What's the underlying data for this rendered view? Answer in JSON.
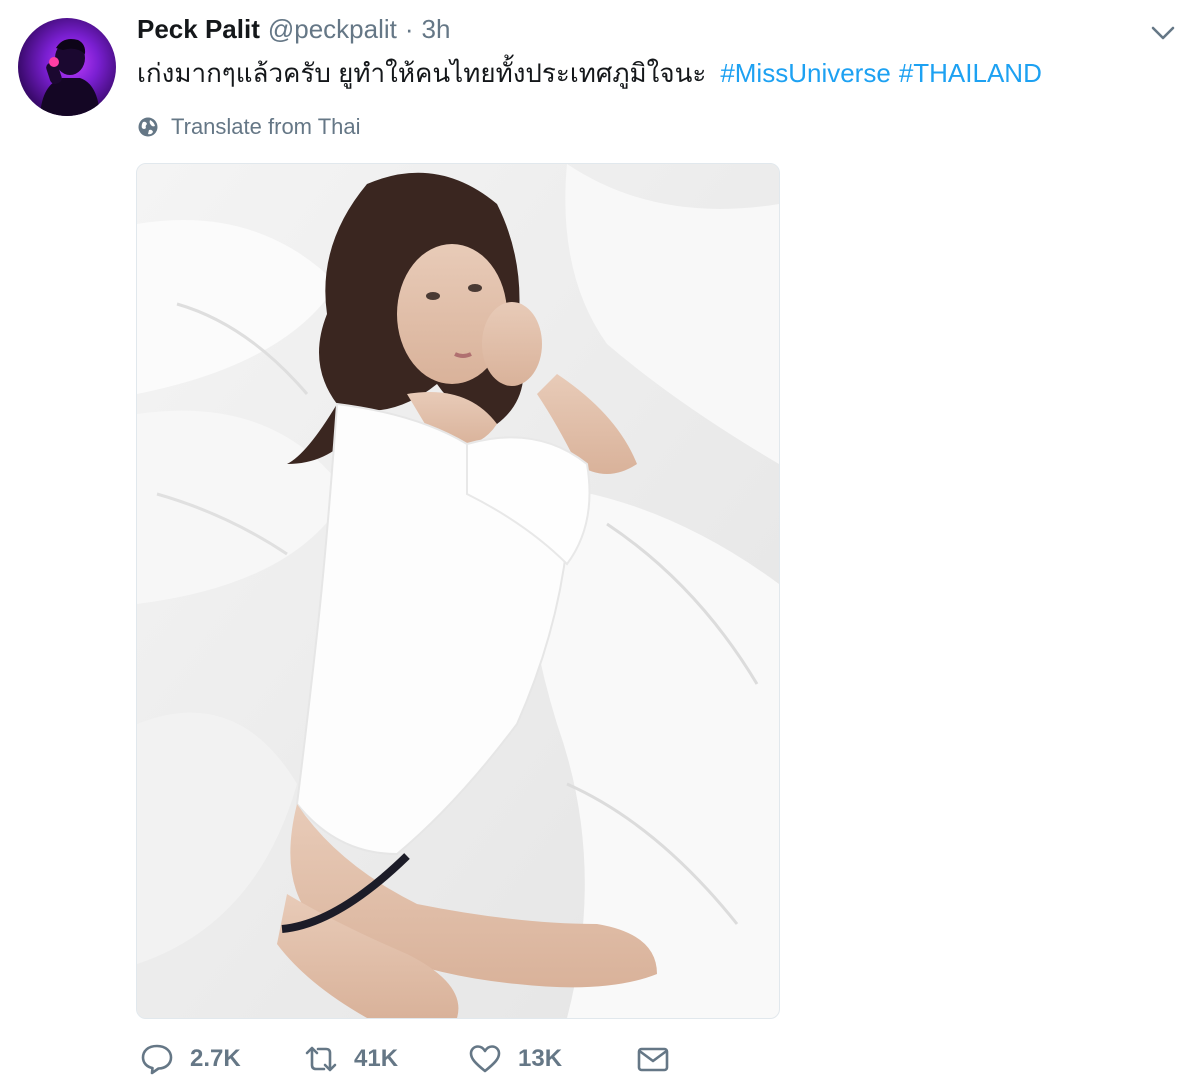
{
  "author": {
    "display_name": "Peck Palit",
    "handle": "@peckpalit",
    "separator": "·",
    "time": "3h"
  },
  "tweet": {
    "text": "เก่งมากๆแล้วครับ ยูทำให้คนไทยทั้งประเทศภูมิใจนะ",
    "hashtags": [
      "#MissUniverse",
      "#THAILAND"
    ],
    "hashtag_color": "#1da1f2"
  },
  "translate": {
    "label": "Translate from Thai",
    "icon": "globe-icon"
  },
  "media": {
    "type": "photo"
  },
  "actions": {
    "reply": {
      "icon": "reply-icon",
      "count": "2.7K"
    },
    "retweet": {
      "icon": "retweet-icon",
      "count": "41K"
    },
    "like": {
      "icon": "heart-icon",
      "count": "13K"
    },
    "message": {
      "icon": "envelope-icon"
    }
  },
  "menu": {
    "icon": "chevron-down-icon"
  },
  "colors": {
    "text": "#14171a",
    "secondary": "#657786",
    "link": "#1da1f2"
  }
}
